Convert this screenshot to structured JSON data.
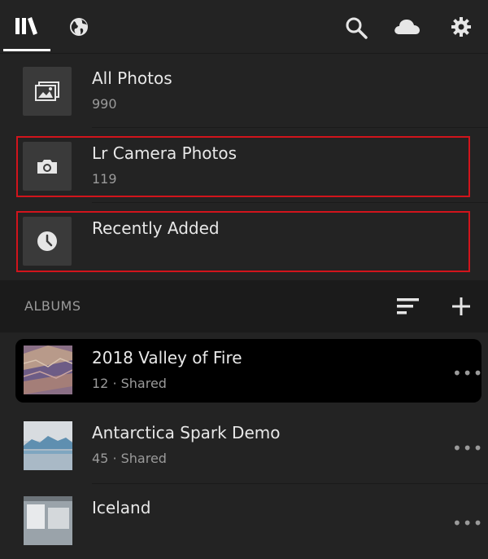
{
  "toolbar": {
    "icons": [
      "library-icon",
      "globe-icon",
      "search-icon",
      "cloud-icon",
      "gear-icon"
    ]
  },
  "library": [
    {
      "title": "All Photos",
      "count": "990",
      "icon": "photo-icon"
    },
    {
      "title": "Lr Camera Photos",
      "count": "119",
      "icon": "camera-icon"
    },
    {
      "title": "Recently Added",
      "count": "",
      "icon": "clock-icon"
    }
  ],
  "albums_header": {
    "label": "ALBUMS"
  },
  "albums": [
    {
      "title": "2018 Valley of Fire",
      "meta": "12 · Shared",
      "more": "•••"
    },
    {
      "title": "Antarctica Spark Demo",
      "meta": "45 · Shared",
      "more": "•••"
    },
    {
      "title": "Iceland",
      "meta": "",
      "more": "•••"
    }
  ],
  "colors": {
    "background": "#232323",
    "highlight": "#d1141c",
    "selected_row": "#000000"
  }
}
